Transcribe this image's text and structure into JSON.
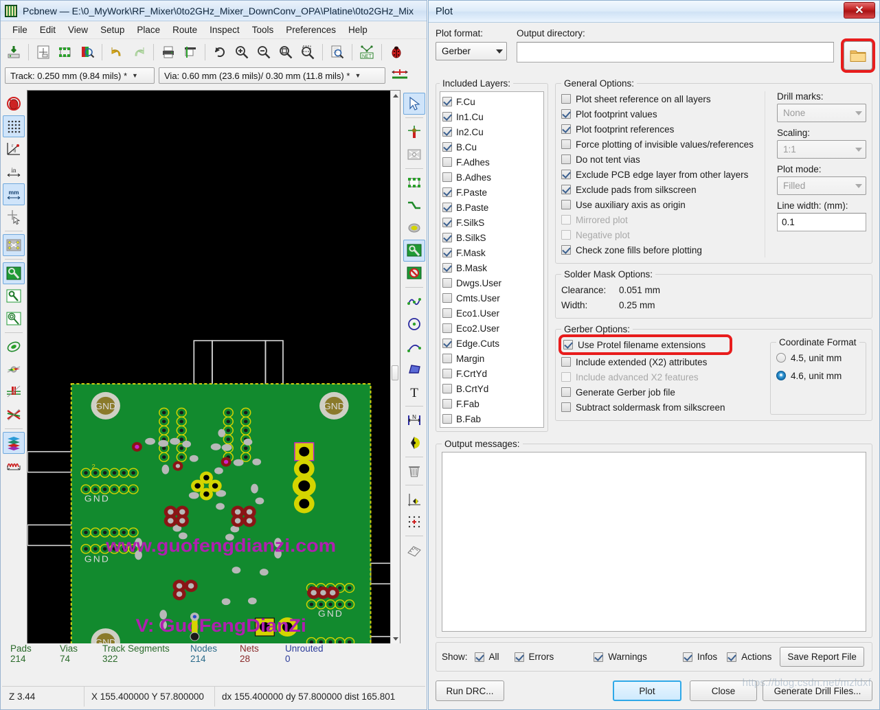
{
  "pcbnew": {
    "title": "Pcbnew — E:\\0_MyWork\\RF_Mixer\\0to2GHz_Mixer_DownConv_OPA\\Platine\\0to2GHz_Mix",
    "menu": [
      "File",
      "Edit",
      "View",
      "Setup",
      "Place",
      "Route",
      "Inspect",
      "Tools",
      "Preferences",
      "Help"
    ],
    "toolbar2": {
      "track": "Track: 0.250 mm (9.84 mils) *",
      "via": "Via: 0.60 mm (23.6 mils)/ 0.30 mm (11.8 mils) *"
    },
    "status_headers": [
      "Pads",
      "Vias",
      "Track Segments",
      "Nodes",
      "Nets",
      "Unrouted"
    ],
    "status_values": [
      "214",
      "74",
      "322",
      "214",
      "28",
      "0"
    ],
    "statusbar": {
      "zoom": "Z 3.44",
      "coords": "X 155.400000  Y 57.800000",
      "delta": "dx 155.400000  dy 57.800000  dist 165.801"
    },
    "board_silk": {
      "line1": "www.guofengdianzi.com",
      "line2": "V: GuoFengDianZi",
      "gnd": "GND"
    }
  },
  "plot": {
    "title": "Plot",
    "close_label": "✕",
    "plot_format_label": "Plot format:",
    "plot_format_value": "Gerber",
    "output_dir_label": "Output directory:",
    "output_dir_value": "",
    "browse_icon": "folder-icon",
    "included_layers_label": "Included Layers:",
    "layers": [
      {
        "label": "F.Cu",
        "checked": true
      },
      {
        "label": "In1.Cu",
        "checked": true
      },
      {
        "label": "In2.Cu",
        "checked": true
      },
      {
        "label": "B.Cu",
        "checked": true
      },
      {
        "label": "F.Adhes",
        "checked": false
      },
      {
        "label": "B.Adhes",
        "checked": false
      },
      {
        "label": "F.Paste",
        "checked": true
      },
      {
        "label": "B.Paste",
        "checked": true
      },
      {
        "label": "F.SilkS",
        "checked": true
      },
      {
        "label": "B.SilkS",
        "checked": true
      },
      {
        "label": "F.Mask",
        "checked": true
      },
      {
        "label": "B.Mask",
        "checked": true
      },
      {
        "label": "Dwgs.User",
        "checked": false
      },
      {
        "label": "Cmts.User",
        "checked": false
      },
      {
        "label": "Eco1.User",
        "checked": false
      },
      {
        "label": "Eco2.User",
        "checked": false
      },
      {
        "label": "Edge.Cuts",
        "checked": true
      },
      {
        "label": "Margin",
        "checked": false
      },
      {
        "label": "F.CrtYd",
        "checked": false
      },
      {
        "label": "B.CrtYd",
        "checked": false
      },
      {
        "label": "F.Fab",
        "checked": false
      },
      {
        "label": "B.Fab",
        "checked": false
      }
    ],
    "general_options_label": "General Options:",
    "general_options": [
      {
        "label": "Plot sheet reference on all layers",
        "checked": false,
        "disabled": false
      },
      {
        "label": "Plot footprint values",
        "checked": true,
        "disabled": false
      },
      {
        "label": "Plot footprint references",
        "checked": true,
        "disabled": false
      },
      {
        "label": "Force plotting of invisible values/references",
        "checked": false,
        "disabled": false
      },
      {
        "label": "Do not tent vias",
        "checked": false,
        "disabled": false
      },
      {
        "label": "Exclude PCB edge layer from other layers",
        "checked": true,
        "disabled": false
      },
      {
        "label": "Exclude pads from silkscreen",
        "checked": true,
        "disabled": false
      },
      {
        "label": "Use auxiliary axis as origin",
        "checked": false,
        "disabled": false
      },
      {
        "label": "Mirrored plot",
        "checked": false,
        "disabled": true
      },
      {
        "label": "Negative plot",
        "checked": false,
        "disabled": true
      },
      {
        "label": "Check zone fills before plotting",
        "checked": true,
        "disabled": false
      }
    ],
    "drill_marks_label": "Drill marks:",
    "drill_marks_value": "None",
    "scaling_label": "Scaling:",
    "scaling_value": "1:1",
    "plot_mode_label": "Plot mode:",
    "plot_mode_value": "Filled",
    "line_width_label": "Line width: (mm):",
    "line_width_value": "0.1",
    "solder_mask_label": "Solder Mask Options:",
    "clearance_label": "Clearance:",
    "clearance_value": "0.051 mm",
    "width_label": "Width:",
    "width_value": "0.25 mm",
    "gerber_options_label": "Gerber Options:",
    "gerber_options": [
      {
        "label": "Use Protel filename extensions",
        "checked": true,
        "disabled": false,
        "highlight": true
      },
      {
        "label": "Include extended (X2) attributes",
        "checked": false,
        "disabled": false,
        "highlight": false
      },
      {
        "label": "Include advanced X2 features",
        "checked": false,
        "disabled": true,
        "highlight": false
      },
      {
        "label": "Generate Gerber job file",
        "checked": false,
        "disabled": false,
        "highlight": false
      },
      {
        "label": "Subtract soldermask from silkscreen",
        "checked": false,
        "disabled": false,
        "highlight": false
      }
    ],
    "coordinate_format_label": "Coordinate Format",
    "coordinate_formats": [
      {
        "label": "4.5, unit mm",
        "selected": false
      },
      {
        "label": "4.6, unit mm",
        "selected": true
      }
    ],
    "output_messages_label": "Output messages:",
    "output_messages_value": "",
    "show_label": "Show:",
    "show_filters": [
      {
        "label": "All",
        "checked": true
      },
      {
        "label": "Errors",
        "checked": true
      },
      {
        "label": "Warnings",
        "checked": true
      },
      {
        "label": "Infos",
        "checked": true
      },
      {
        "label": "Actions",
        "checked": true
      }
    ],
    "save_report_label": "Save Report File",
    "buttons": {
      "run_drc": "Run DRC...",
      "plot": "Plot",
      "close": "Close",
      "generate_drill": "Generate Drill Files..."
    }
  },
  "watermark": "https://blog.csdn.net/mzldxf",
  "colors": {
    "accent_blue": "#2ea8e8",
    "highlight_red": "#e81c1c",
    "pcb_green": "#128a2e",
    "silk_magenta": "#b01fb0",
    "pad_yellow": "#d9d900"
  }
}
